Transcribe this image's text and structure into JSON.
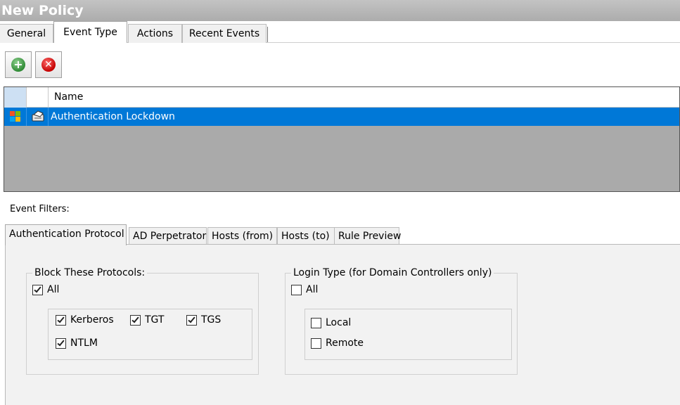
{
  "window": {
    "title": "New Policy"
  },
  "tabs": [
    {
      "label": "General",
      "active": false
    },
    {
      "label": "Event Type",
      "active": true
    },
    {
      "label": "Actions",
      "active": false
    },
    {
      "label": "Recent Events",
      "active": false
    }
  ],
  "toolbar": {
    "add_icon": "plus-circle-icon",
    "remove_icon": "x-circle-icon",
    "add_glyph": "+",
    "remove_glyph": "✕"
  },
  "grid": {
    "columns": [
      "",
      "",
      "Name"
    ],
    "rows": [
      {
        "name": "Authentication Lockdown",
        "selected": true,
        "icons": [
          "windows-logo-icon",
          "policy-icon"
        ]
      }
    ],
    "selection_color": "#0078d7"
  },
  "filters": {
    "label": "Event Filters:",
    "tabs": [
      {
        "label": "Authentication Protocol",
        "active": true
      },
      {
        "label": "AD Perpetrator",
        "active": false
      },
      {
        "label": "Hosts (from)",
        "active": false
      },
      {
        "label": "Hosts (to)",
        "active": false
      },
      {
        "label": "Rule Preview",
        "active": false
      }
    ],
    "block_protocols": {
      "title": "Block These Protocols:",
      "all": {
        "label": "All",
        "checked": true
      },
      "options": [
        {
          "label": "Kerberos",
          "checked": true
        },
        {
          "label": "TGT",
          "checked": true
        },
        {
          "label": "TGS",
          "checked": true
        },
        {
          "label": "NTLM",
          "checked": true
        }
      ]
    },
    "login_type": {
      "title": "Login Type (for Domain Controllers only)",
      "all": {
        "label": "All",
        "checked": false
      },
      "options": [
        {
          "label": "Local",
          "checked": false
        },
        {
          "label": "Remote",
          "checked": false
        }
      ]
    }
  }
}
